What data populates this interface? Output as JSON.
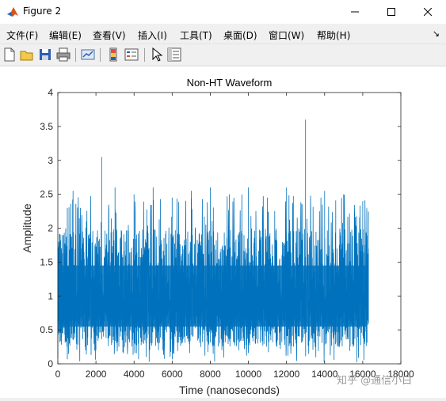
{
  "window": {
    "title": "Figure 2"
  },
  "menu": {
    "items": [
      "文件(F)",
      "编辑(E)",
      "查看(V)",
      "插入(I)",
      "工具(T)",
      "桌面(D)",
      "窗口(W)",
      "帮助(H)"
    ],
    "overflow_arrow": "↘"
  },
  "toolbar": {
    "icons": [
      "new-figure-icon",
      "open-icon",
      "save-icon",
      "print-icon",
      "link-plot-icon",
      "colorbar-icon",
      "legend-icon",
      "pointer-icon",
      "property-inspector-icon"
    ]
  },
  "watermark": "知乎 @通信小白",
  "colors": {
    "line": "#0072bd",
    "axes": "#262626"
  },
  "chart_data": {
    "type": "line",
    "title": "Non-HT Waveform",
    "xlabel": "Time (nanoseconds)",
    "ylabel": "Amplitude",
    "xlim": [
      0,
      18000
    ],
    "ylim": [
      0,
      4
    ],
    "xticks": [
      0,
      2000,
      4000,
      6000,
      8000,
      10000,
      12000,
      14000,
      16000,
      18000
    ],
    "yticks": [
      0,
      0.5,
      1,
      1.5,
      2,
      2.5,
      3,
      3.5,
      4
    ],
    "x_range": [
      0,
      16300
    ],
    "series": [
      {
        "description_values": "dense noise-like magnitude, mostly between 0.2 and 2.5",
        "x": [
          0,
          100,
          200,
          300,
          400,
          500,
          600,
          800,
          1000,
          1500,
          2000,
          2300,
          3000,
          3500,
          4000,
          4500,
          5000,
          5500,
          6000,
          6500,
          7000,
          7500,
          8000,
          8500,
          9000,
          9500,
          10000,
          10500,
          11000,
          11500,
          12000,
          12500,
          13000,
          13500,
          14000,
          14500,
          15000,
          15500,
          16000,
          16300
        ],
        "y": [
          0.9,
          1.3,
          0.4,
          1.6,
          0.5,
          2.3,
          0.3,
          2.55,
          0.3,
          2.1,
          0.2,
          3.05,
          2.6,
          0.25,
          2.5,
          0.3,
          2.6,
          0.2,
          2.45,
          0.3,
          2.55,
          0.25,
          2.6,
          0.3,
          2.5,
          0.2,
          2.6,
          0.3,
          2.45,
          0.25,
          2.6,
          0.3,
          3.6,
          0.25,
          2.55,
          0.3,
          2.5,
          0.25,
          2.4,
          1.7
        ]
      }
    ]
  }
}
